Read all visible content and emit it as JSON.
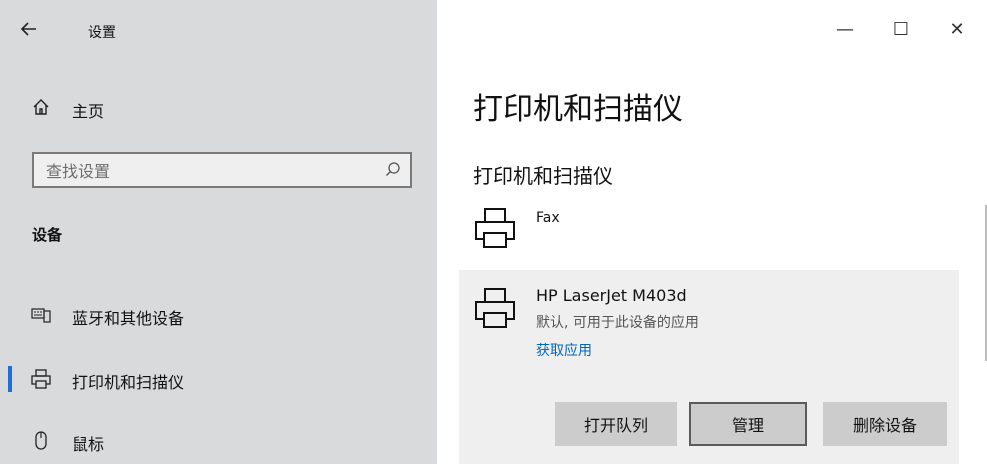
{
  "window": {
    "title": "设置",
    "controls": {
      "minimize": "—",
      "maximize": "☐",
      "close": "✕"
    }
  },
  "sidebar": {
    "home_label": "主页",
    "search": {
      "placeholder": "查找设置"
    },
    "section_title": "设备",
    "items": [
      {
        "label": "蓝牙和其他设备",
        "icon": "keyboard-phone-icon",
        "active": false
      },
      {
        "label": "打印机和扫描仪",
        "icon": "printer-icon",
        "active": true
      },
      {
        "label": "鼠标",
        "icon": "mouse-icon",
        "active": false
      }
    ]
  },
  "main": {
    "page_title": "打印机和扫描仪",
    "section_heading": "打印机和扫描仪",
    "devices": [
      {
        "name": "Fax",
        "icon": "printer-icon"
      },
      {
        "name": "HP LaserJet M403d",
        "status": "默认, 可用于此设备的应用",
        "link": "获取应用",
        "icon": "printer-icon",
        "buttons": {
          "open_queue": "打开队列",
          "manage": "管理",
          "remove": "删除设备"
        }
      }
    ]
  },
  "colors": {
    "sidebar_bg": "#d9dadb",
    "accent": "#1e6fd6",
    "link": "#0067c0",
    "button_bg": "#cccccc",
    "selected_card_bg": "#efefef"
  }
}
